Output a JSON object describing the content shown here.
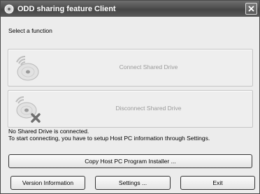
{
  "window": {
    "title": "ODD sharing feature Client"
  },
  "prompt": "Select a function",
  "functions": [
    {
      "label": "Connect Shared Drive",
      "icon": "disc-signal-icon"
    },
    {
      "label": "Disconnect Shared Drive",
      "icon": "disc-disconnect-icon"
    }
  ],
  "status": {
    "line1": "No Shared Drive is connected.",
    "line2": "To start connecting, you have to setup Host PC information through Settings."
  },
  "buttons": {
    "copy_installer": "Copy Host PC Program Installer ...",
    "version": "Version Information",
    "settings": "Settings ...",
    "exit": "Exit"
  }
}
